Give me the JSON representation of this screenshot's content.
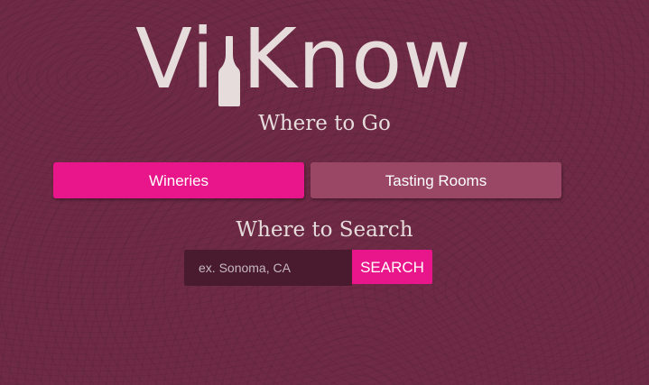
{
  "logo": {
    "part1": "Vi",
    "part2": "Know",
    "icon": "wine-bottle-icon"
  },
  "where_to_go": {
    "title": "Where to Go",
    "tabs": [
      {
        "label": "Wineries",
        "selected": true
      },
      {
        "label": "Tasting Rooms",
        "selected": false
      }
    ]
  },
  "where_to_search": {
    "title": "Where to Search",
    "input_value": "",
    "input_placeholder": "ex. Sonoma, CA",
    "button_label": "SEARCH"
  },
  "colors": {
    "background": "#6f2a46",
    "accent": "#e8168a",
    "tab_inactive": "#9a4766",
    "input_bg": "#4a1a2e",
    "logo_text": "#e6dcdc"
  }
}
